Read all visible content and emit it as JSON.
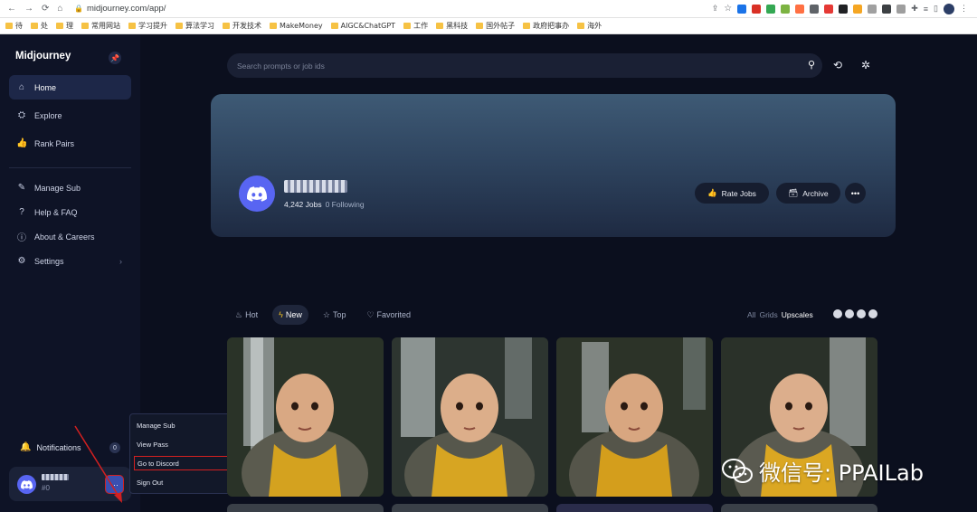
{
  "browser": {
    "url": "midjourney.com/app/",
    "bookmarks": [
      "待",
      "处",
      "理",
      "常用网站",
      "学习提升",
      "算法学习",
      "开发技术",
      "MakeMoney",
      "AIGC&ChatGPT",
      "工作",
      "黑科技",
      "国外帖子",
      "政府把事办",
      "海外"
    ]
  },
  "sidebar": {
    "brand": "Midjourney",
    "nav": [
      {
        "label": "Home",
        "icon": "home-icon",
        "active": true
      },
      {
        "label": "Explore",
        "icon": "explore-icon"
      },
      {
        "label": "Rank Pairs",
        "icon": "thumbs-up-icon"
      }
    ],
    "secondary": [
      {
        "label": "Manage Sub",
        "icon": "edit-icon"
      },
      {
        "label": "Help & FAQ",
        "icon": "help-icon"
      },
      {
        "label": "About & Careers",
        "icon": "info-icon"
      },
      {
        "label": "Settings",
        "icon": "gear-icon"
      }
    ],
    "notifications_label": "Notifications",
    "notifications_count": "0",
    "user_tag": "#0"
  },
  "menu": {
    "items": [
      {
        "label": "Manage Sub",
        "icon": "user-icon"
      },
      {
        "label": "View Pass",
        "icon": "pass-icon"
      },
      {
        "label": "Go to Discord",
        "icon": "external-link-icon",
        "highlighted": true
      },
      {
        "label": "Sign Out",
        "icon": "sign-out-icon"
      }
    ]
  },
  "search": {
    "placeholder": "Search prompts or job ids"
  },
  "profile": {
    "jobs": "4,242 Jobs",
    "following": "0 Following",
    "rate_jobs": "Rate Jobs",
    "archive": "Archive"
  },
  "feed": {
    "filters": [
      {
        "label": "Hot",
        "icon": "fire-icon"
      },
      {
        "label": "New",
        "icon": "bolt-icon",
        "active": true
      },
      {
        "label": "Top",
        "icon": "star-icon"
      },
      {
        "label": "Favorited",
        "icon": "heart-icon"
      }
    ],
    "view_options": [
      "All",
      "Grids",
      "Upscales"
    ],
    "active_view": "Upscales"
  },
  "watermark": "微信号: PPAILab",
  "colors": {
    "accent": "#5865f2",
    "highlight": "#d32020",
    "background": "#0b0f1e"
  }
}
